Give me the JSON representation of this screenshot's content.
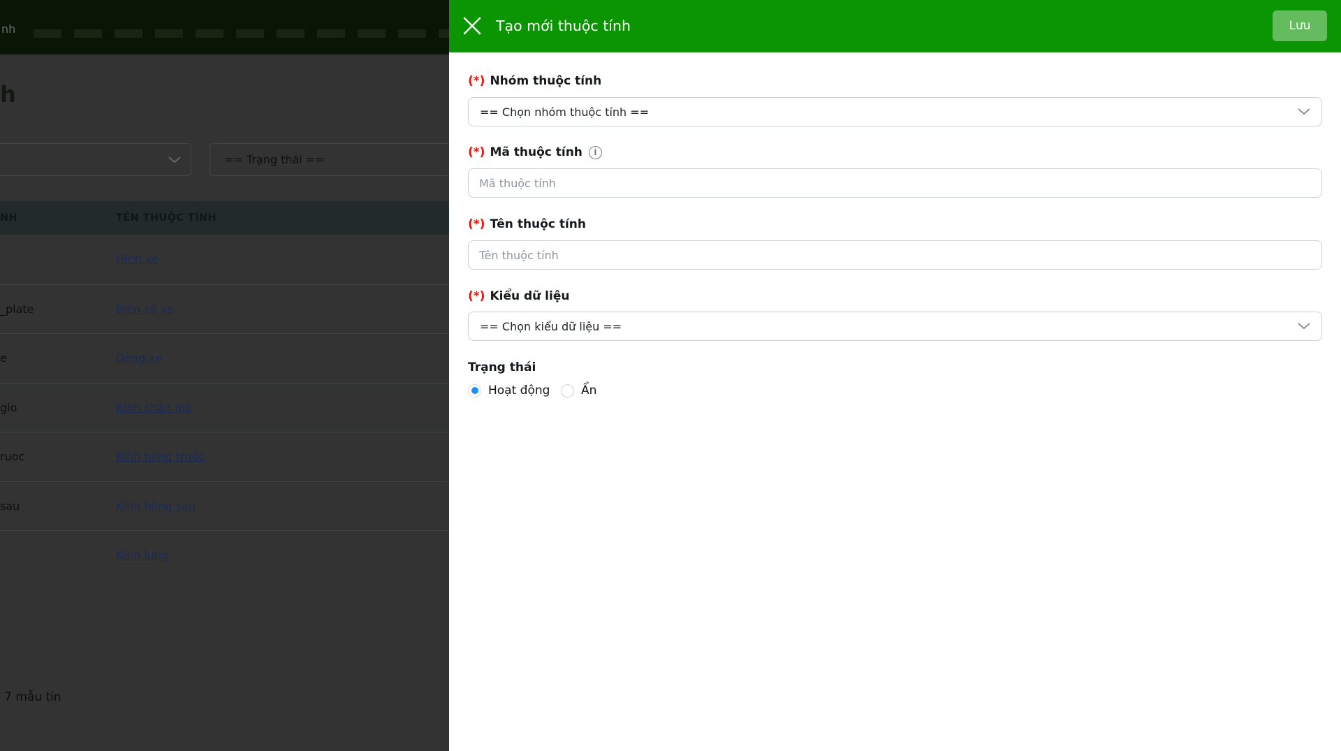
{
  "backdrop": {
    "navbar_fragment": "nh",
    "page_title_fragment": "h",
    "filters": {
      "status": "== Trạng thái =="
    },
    "table": {
      "columns": [
        "NH",
        "TÊN THUỘC TÍNH"
      ],
      "rows": [
        {
          "code": "",
          "name": "Hình xe"
        },
        {
          "code": "_plate",
          "name": "Biển số xe"
        },
        {
          "code": "e",
          "name": "Dòng xe"
        },
        {
          "code": "gio",
          "name": "Kính chắn gió"
        },
        {
          "code": "ruoc",
          "name": "Kính hông trước"
        },
        {
          "code": "sau",
          "name": "Kính hông sau"
        },
        {
          "code": "",
          "name": "Kính lưng"
        }
      ]
    },
    "pagination": "/ 7 mẫu tin"
  },
  "panel": {
    "title": "Tạo mới thuộc tính",
    "save_label": "Lưu",
    "required_marker": "(*)",
    "icons": {
      "info_glyph": "i"
    },
    "fields": {
      "group": {
        "label": "Nhóm thuộc tính",
        "value": "== Chọn nhóm thuộc tính =="
      },
      "code": {
        "label": "Mã thuộc tính",
        "placeholder": "Mã thuộc tính"
      },
      "name": {
        "label": "Tên thuộc tính",
        "placeholder": "Tên thuộc tính"
      },
      "datatype": {
        "label": "Kiểu dữ liệu",
        "value": "== Chọn kiểu dữ liệu =="
      },
      "status": {
        "label": "Trạng thái",
        "options": [
          {
            "label": "Hoạt động",
            "selected": true
          },
          {
            "label": "Ẩn",
            "selected": false
          }
        ]
      }
    },
    "colors": {
      "header_green": "#0b9502",
      "radio_blue": "#1e8fff",
      "required_red": "#e81309"
    }
  }
}
